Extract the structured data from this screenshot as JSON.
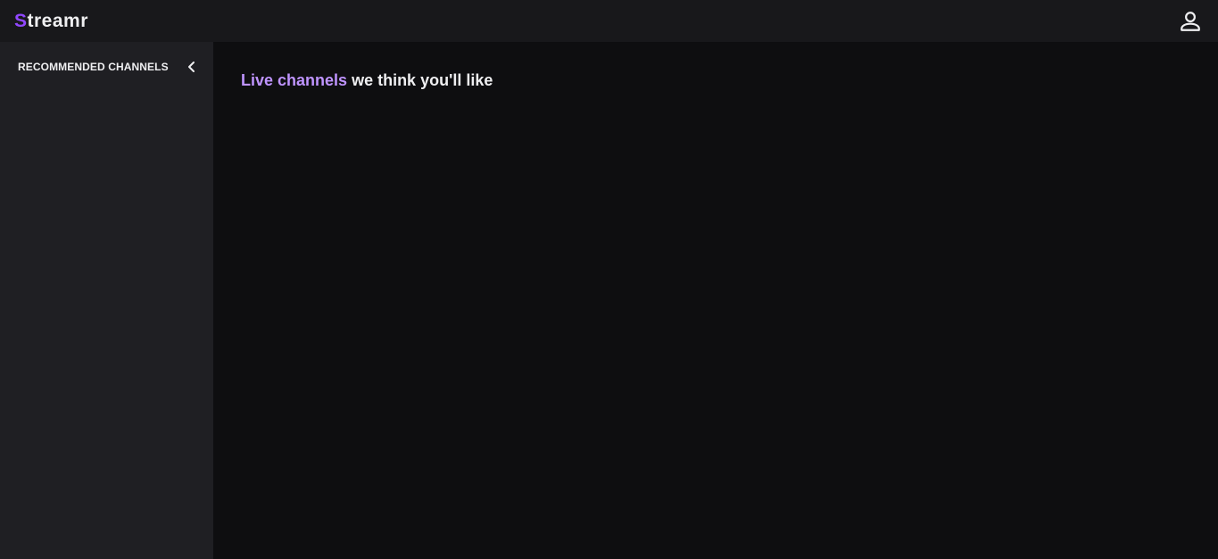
{
  "header": {
    "logo_first_letter": "S",
    "logo_rest": "treamr",
    "profile_icon": "user-icon"
  },
  "sidebar": {
    "title": "RECOMMENDED CHANNELS",
    "collapse_icon": "chevron-left-icon"
  },
  "main": {
    "heading_accent": "Live channels",
    "heading_rest": " we think you'll like"
  },
  "colors": {
    "brand": "#9147ff",
    "accent_text": "#bf94ff",
    "topbar_bg": "#18181b",
    "sidebar_bg": "#1f1f23",
    "main_bg": "#0e0e10",
    "text": "#efeff1"
  }
}
